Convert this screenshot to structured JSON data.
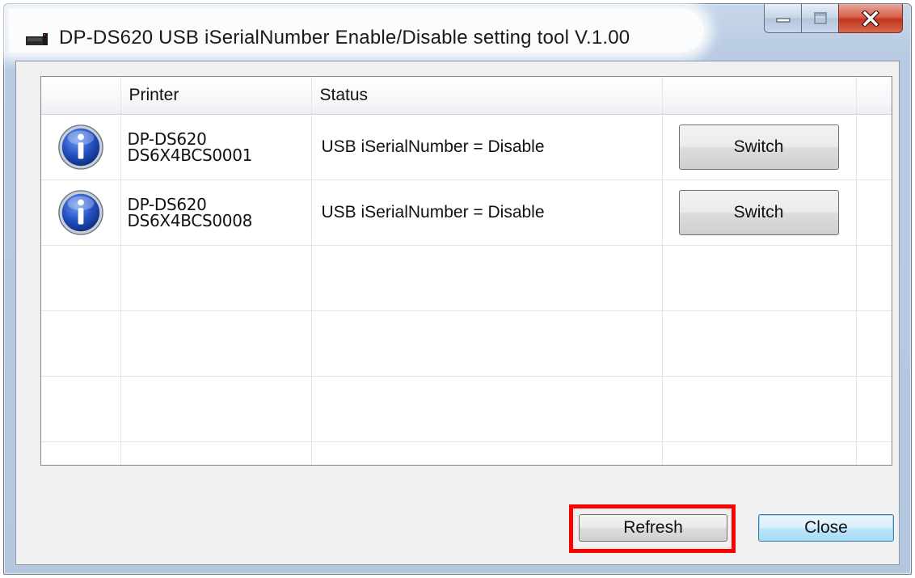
{
  "window": {
    "title": "DP-DS620   USB iSerialNumber Enable/Disable setting tool   V.1.00"
  },
  "grid": {
    "columns": [
      {
        "label": ""
      },
      {
        "label": "Printer"
      },
      {
        "label": "Status"
      },
      {
        "label": ""
      }
    ],
    "rows": [
      {
        "icon": "info-icon",
        "printer_model": "DP-DS620",
        "printer_serial": "DS6X4BCS0001",
        "status": "USB iSerialNumber = Disable",
        "action_label": "Switch"
      },
      {
        "icon": "info-icon",
        "printer_model": "DP-DS620",
        "printer_serial": "DS6X4BCS0008",
        "status": "USB iSerialNumber = Disable",
        "action_label": "Switch"
      }
    ]
  },
  "buttons": {
    "refresh_label": "Refresh",
    "close_label": "Close"
  },
  "colors": {
    "highlight": "#ff0000",
    "info_icon": "#1e4fb8"
  }
}
